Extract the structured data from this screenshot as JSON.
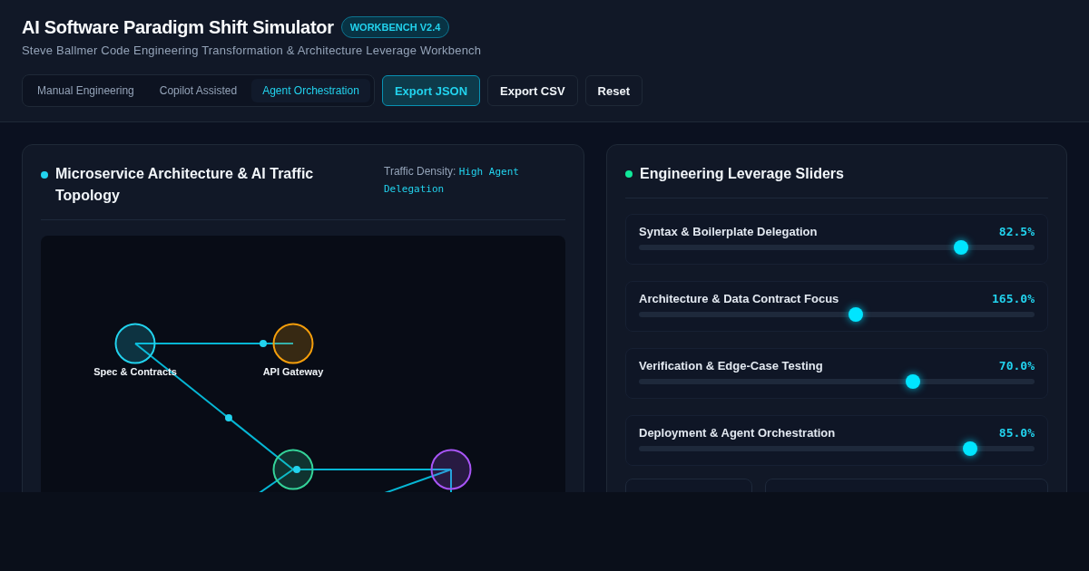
{
  "header": {
    "title": "AI Software Paradigm Shift Simulator",
    "badge": "WORKBENCH V2.4",
    "subtitle": "Steve Ballmer Code Engineering Transformation & Architecture Leverage Workbench"
  },
  "mode_tabs": [
    {
      "label": "Manual Engineering",
      "selected": false
    },
    {
      "label": "Copilot Assisted",
      "selected": false
    },
    {
      "label": "Agent Orchestration",
      "selected": true
    }
  ],
  "actions": [
    {
      "label": "Export JSON",
      "kind": "primary"
    },
    {
      "label": "Export CSV",
      "kind": "secondary"
    },
    {
      "label": "Reset",
      "kind": "secondary"
    }
  ],
  "topology": {
    "title": "Microservice Architecture & AI Traffic Topology",
    "density_label": "Traffic Density:",
    "density_value": "High Agent Delegation",
    "nodes": [
      {
        "label": "Spec & Contracts",
        "color": "#22d3ee"
      },
      {
        "label": "API Gateway",
        "color": "#f59e0b"
      },
      {
        "color": "#34d399"
      },
      {
        "color": "#a855f7"
      }
    ]
  },
  "sliders_panel": {
    "title": "Engineering Leverage Sliders",
    "sliders": [
      {
        "name": "Syntax & Boilerplate Delegation",
        "reading": "82.5%",
        "level": 0.814
      },
      {
        "name": "Architecture & Data Contract Focus",
        "reading": "165.0%",
        "level": 0.548
      },
      {
        "name": "Verification & Edge-Case Testing",
        "reading": "70.0%",
        "level": 0.693
      },
      {
        "name": "Deployment & Agent Orchestration",
        "reading": "85.0%",
        "level": 0.837
      }
    ]
  }
}
